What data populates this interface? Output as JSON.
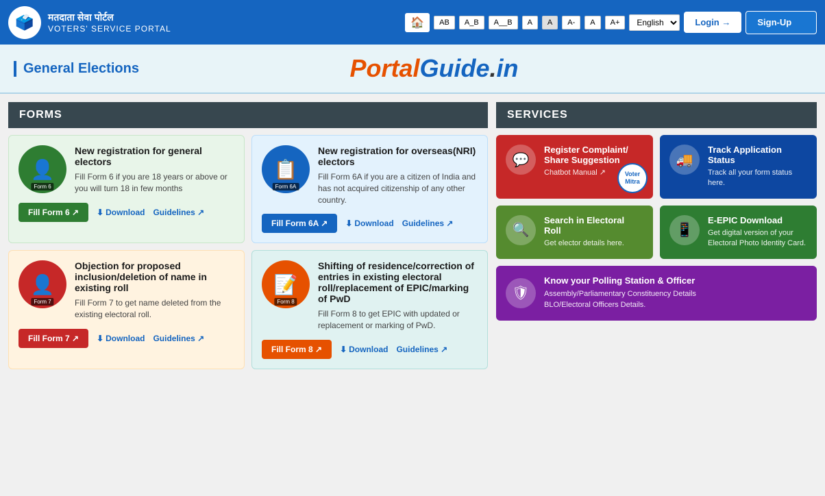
{
  "topNav": {
    "logoHindi": "मतदाता सेवा पोर्टल",
    "logoEnglish": "VOTERS' SERVICE PORTAL",
    "fontButtons": [
      "AB",
      "A_B",
      "A__B",
      "A",
      "A",
      "A-",
      "A",
      "A+"
    ],
    "language": "English",
    "loginLabel": "Login →",
    "signupLabel": "Sign-Up 👤"
  },
  "banner": {
    "title": "General Elections",
    "portalText": "Portal",
    "guideText": "Guide",
    "dotText": ".",
    "inText": "in"
  },
  "forms": {
    "header": "FORMS",
    "cards": [
      {
        "id": "form6",
        "badge": "Form 6",
        "title": "New registration for general electors",
        "description": "Fill Form 6 if you are 18 years or above or you will turn 18 in few months",
        "fillLabel": "Fill Form 6 ↗",
        "downloadLabel": "Download",
        "guidelinesLabel": "Guidelines ↗",
        "color": "green"
      },
      {
        "id": "form6a",
        "badge": "Form 6A",
        "title": "New registration for overseas(NRI) electors",
        "description": "Fill Form 6A if you are a citizen of India and has not acquired citizenship of any other country.",
        "fillLabel": "Fill Form 6A ↗",
        "downloadLabel": "Download",
        "guidelinesLabel": "Guidelines ↗",
        "color": "blue"
      },
      {
        "id": "form7",
        "badge": "Form 7",
        "title": "Objection for proposed inclusion/deletion of name in existing roll",
        "description": "Fill Form 7 to get name deleted from the existing electoral roll.",
        "fillLabel": "Fill Form 7 ↗",
        "downloadLabel": "Download",
        "guidelinesLabel": "Guidelines ↗",
        "color": "orange"
      },
      {
        "id": "form8",
        "badge": "Form 8",
        "title": "Shifting of residence/correction of entries in existing electoral roll/replacement of EPIC/marking of PwD",
        "description": "Fill Form 8 to get EPIC with updated or replacement or marking of PwD.",
        "fillLabel": "Fill Form 8 ↗",
        "downloadLabel": "Download",
        "guidelinesLabel": "Guidelines ↗",
        "color": "teal"
      }
    ]
  },
  "services": {
    "header": "SERVICES",
    "cards": [
      {
        "id": "register-complaint",
        "title": "Register Complaint/ Share Suggestion",
        "description": "",
        "chatbotLabel": "Chatbot Manual ↗",
        "color": "red-dark",
        "icon": "💬"
      },
      {
        "id": "track-application",
        "title": "Track Application Status",
        "description": "Track all your form status here.",
        "color": "navy",
        "icon": "🚚"
      },
      {
        "id": "search-roll",
        "title": "Search in Electoral Roll",
        "description": "Get elector details here.",
        "color": "olive",
        "icon": "🔍"
      },
      {
        "id": "eepic-download",
        "title": "E-EPIC Download",
        "description": "Get digital version of your Electoral Photo Identity Card.",
        "color": "dark-green",
        "icon": "📱"
      },
      {
        "id": "polling-station",
        "title": "Know your Polling Station & Officer",
        "description1": "Assembly/Parliamentary Constituency Details",
        "description2": "BLO/Electoral Officers Details.",
        "color": "purple",
        "icon": "🛡"
      }
    ]
  }
}
